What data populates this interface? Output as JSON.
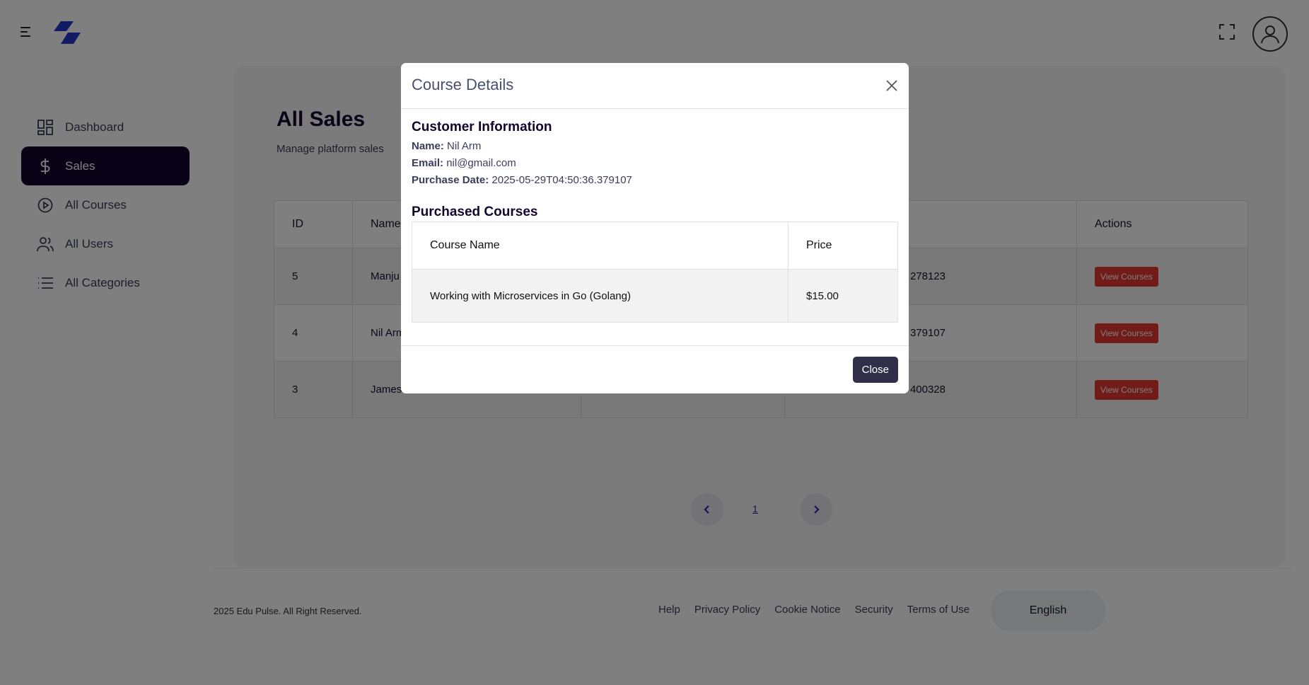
{
  "sidebar": {
    "items": [
      {
        "label": "Dashboard",
        "icon": "dashboard-icon"
      },
      {
        "label": "Sales",
        "icon": "dollar-icon",
        "active": true
      },
      {
        "label": "All Courses",
        "icon": "play-circle-icon"
      },
      {
        "label": "All Users",
        "icon": "users-icon"
      },
      {
        "label": "All Categories",
        "icon": "list-icon"
      }
    ]
  },
  "page": {
    "title": "All Sales",
    "subtitle": "Manage platform sales"
  },
  "table": {
    "headers": {
      "id": "ID",
      "name": "Name",
      "actions": "Actions"
    },
    "rows": [
      {
        "id": "5",
        "name": "Manju",
        "date": "278123",
        "action": "View Courses"
      },
      {
        "id": "4",
        "name": "Nil Arm",
        "date": "379107",
        "action": "View Courses"
      },
      {
        "id": "3",
        "name": "James",
        "date": "400328",
        "action": "View Courses"
      }
    ]
  },
  "pagination": {
    "current": "1"
  },
  "footer": {
    "copyright": "2025 Edu Pulse. All Right Reserved.",
    "links": [
      "Help",
      "Privacy Policy",
      "Cookie Notice",
      "Security",
      "Terms of Use"
    ],
    "language": "English"
  },
  "modal": {
    "title": "Course Details",
    "customer_heading": "Customer Information",
    "name_label": "Name:",
    "name_value": "Nil Arm",
    "email_label": "Email:",
    "email_value": "nil@gmail.com",
    "date_label": "Purchase Date:",
    "date_value": "2025-05-29T04:50:36.379107",
    "courses_heading": "Purchased Courses",
    "course_headers": {
      "name": "Course Name",
      "price": "Price"
    },
    "courses": [
      {
        "name": "Working with Microservices in Go (Golang)",
        "price": "$15.00"
      }
    ],
    "close_label": "Close"
  },
  "colors": {
    "primary": "#14052e",
    "danger": "#e53935",
    "logo": "#2636c9"
  }
}
